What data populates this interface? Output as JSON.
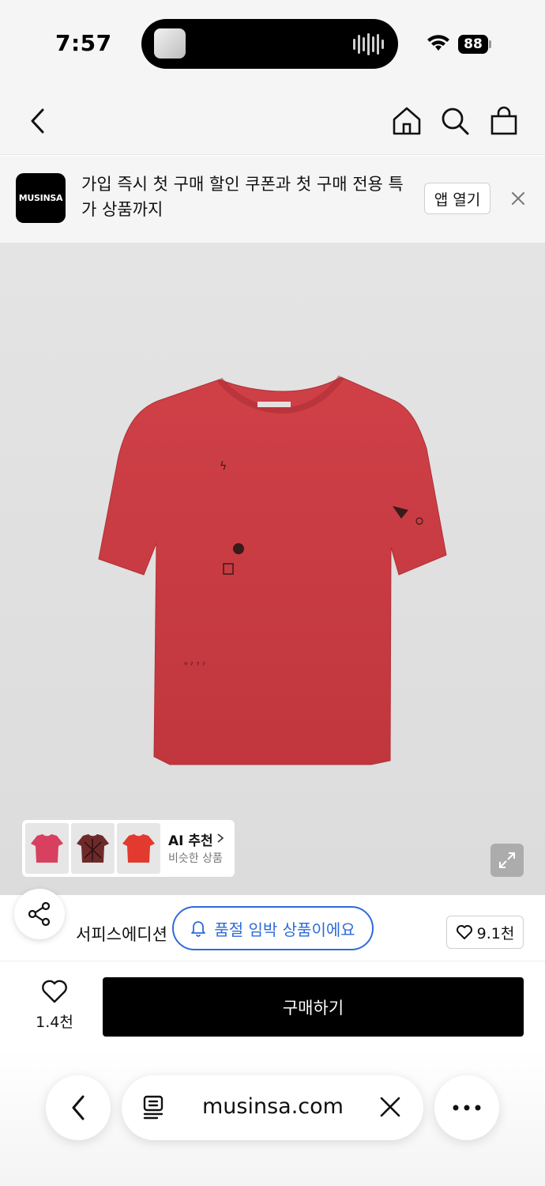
{
  "status_bar": {
    "time": "7:57",
    "battery": "88"
  },
  "nav": {
    "back_icon": "chevron-left-icon",
    "home_icon": "home-icon",
    "search_icon": "search-icon",
    "cart_icon": "shopping-bag-icon"
  },
  "app_banner": {
    "logo_text": "MUSINSA",
    "message": "가입 즉시 첫 구매 할인 쿠폰과 첫 구매 전용 특가 상품까지",
    "open_label": "앱 열기",
    "close_icon": "close-icon"
  },
  "product_image": {
    "background_color": "#e0e0e0",
    "shirt_color": "#c9373e",
    "ai_recommendation": {
      "title": "AI 추천",
      "subtitle": "비슷한 상품",
      "thumbnails": [
        "pink-tshirt",
        "brown-print-tshirt",
        "red-tshirt"
      ]
    },
    "expand_icon": "expand-icon"
  },
  "info": {
    "share_icon": "share-icon",
    "brand": "서피스에디션",
    "soldout_notice": "품절 임박 상품이에요",
    "soldout_icon": "bell-icon",
    "like_count": "9.1천",
    "accent_color": "#2e6bd9"
  },
  "buy_bar": {
    "wish_count": "1.4천",
    "buy_label": "구매하기"
  },
  "browser": {
    "url": "musinsa.com",
    "back_icon": "chevron-left-icon",
    "tabs_icon": "reader-icon",
    "close_icon": "close-icon",
    "more_icon": "more-icon"
  }
}
